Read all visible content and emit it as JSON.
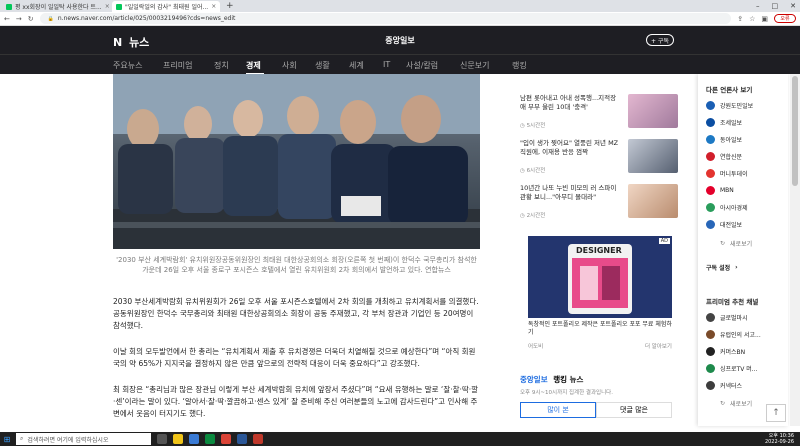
{
  "browser": {
    "tabs": [
      {
        "title": "평 xx회장이 일일탁 사용한다 트..."
      },
      {
        "title": "\"일일락일의 감사\" 최태원 일어..."
      }
    ],
    "url": "n.news.naver.com/article/025/0003219496?cds=news_edit",
    "profile": "오류"
  },
  "header": {
    "logo_prefix": "N",
    "logo_text": "뉴스",
    "press": "중앙일보",
    "subscribe": "+ 구독"
  },
  "nav": {
    "items": [
      "주요뉴스",
      "프리미엄",
      "정치",
      "경제",
      "사회",
      "생활",
      "세계",
      "IT",
      "사설/칼럼",
      "신문보기",
      "랭킹"
    ],
    "active": "경제"
  },
  "article": {
    "caption": "'2030 부산 세계박람회' 유치위원장공동위원장인 최태원 대한상공회의소 회장(오른쪽 첫 번째)이 한덕수 국무총리가 참석한 가운데 26일 오후 서울 종로구 포시즌스 호텔에서 열린 유치위원회 2차 회의에서 발언하고 있다. 연합뉴스",
    "p1": "2030 부산세계박람회 유치위원회가 26일 오후 서울 포시즌스호텔에서 2차 회의를 개최하고 유치계획서를 의결했다. 공동위원장인 한덕수 국무총리와 최태원 대한상공회의소 회장이 공동 주재했고, 각 부처 장관과 기업인 등 20여명이 참석했다.",
    "p2": "이날 회의 모두발언에서 한 총리는 “유치계획서 제출 후 유치경쟁은 더욱더 치열해질 것으로 예상한다”며 “아직 회원국의 약 65%가 지지국을 결정하지 않은 만큼 앞으로의 전략적 대응이 더욱 중요하다”고 강조했다.",
    "p3": "최 회장은 “총리님과 많은 장관님 이렇게 부산 세계박람회 유치에 앞장서 주셨다”며 “요새 유행하는 말로 ‘잘·찰·딱·깔·센’이라는 말이 있다. ‘알아서·잘·딱·깔끔하고·센스 있게’ 잘 준비해 주신 여러분들의 노고에 감사드린다”고 인사해 주변에서 웃음이 터지기도 했다."
  },
  "sidebar": {
    "news": [
      {
        "title": "남편 롯아내고 아내 성폭행...지적장 애 부부 울린 10대 '충격'",
        "time": "5시간전"
      },
      {
        "title": "\"입이 생가 찢어요\" 열풍린 저년 MZ 직원에, 이재용 반응 껌짝",
        "time": "6시간전"
      },
      {
        "title": "10년간 나또 누빈 미모의 러 스파이 관황 보니...\"아무디 몰대라\"",
        "time": "2시간전"
      }
    ],
    "ad": {
      "badge": "AD",
      "brand_text": "DESIGNER",
      "text": "독창적인 포트폴리오 제작은 포트폴리오 포포 무료 체험하기",
      "advertiser": "어도비",
      "more": "더 알아보기"
    },
    "ranking": {
      "press": "중앙일보",
      "title": "랭킹 뉴스",
      "sub": "오후 9시~10시까지 집계한 결과입니다.",
      "tab_popular": "많이 본",
      "tab_comment": "댓글 많은"
    }
  },
  "right_panel": {
    "title1": "다른 언론사 보기",
    "presses1": [
      {
        "name": "강원도민일보",
        "color": "#1a5fb4"
      },
      {
        "name": "조세일보",
        "color": "#0b4ea2"
      },
      {
        "name": "동아일보",
        "color": "#1d79c4"
      },
      {
        "name": "연합신문",
        "color": "#d11f2b"
      },
      {
        "name": "머니투데이",
        "color": "#e3342f"
      },
      {
        "name": "MBN",
        "color": "#e4002b"
      },
      {
        "name": "아시아경제",
        "color": "#2a9d5c"
      },
      {
        "name": "대전일보",
        "color": "#2866b8"
      }
    ],
    "more1": "새로보기",
    "setting": "구독 설정",
    "title2": "프리미엄 추천 채널",
    "presses2": [
      {
        "name": "글로벌마시",
        "color": "#444444"
      },
      {
        "name": "유럽인의 서고...",
        "color": "#7a4b2a"
      },
      {
        "name": "커머스BN",
        "color": "#222222"
      },
      {
        "name": "싱프로TV 머...",
        "color": "#1e8a4c"
      },
      {
        "name": "커넥터스",
        "color": "#3d3d3d"
      }
    ],
    "more2": "새로보기"
  },
  "taskbar": {
    "search": "검색하려면 여기에 입력하십시오",
    "time": "오후 10:36",
    "date": "2022-09-26"
  }
}
